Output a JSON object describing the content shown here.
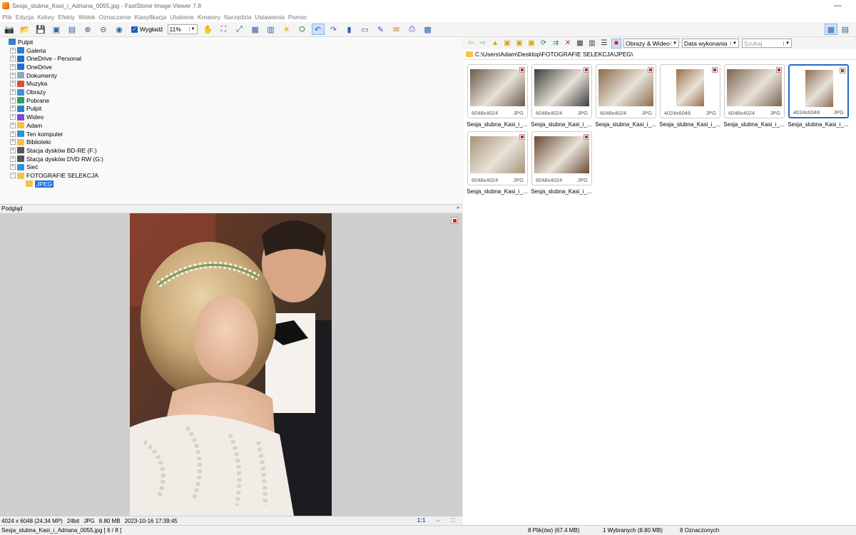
{
  "window": {
    "title": "Sesja_slubna_Kasi_i_Adriana_0055.jpg  -  FastStone Image Viewer 7.8",
    "minimize": "—"
  },
  "menu": [
    "Plik",
    "Edycja",
    "Kolory",
    "Efekty",
    "Widok",
    "Oznaczanie",
    "Klasyfikacja",
    "Ulubione",
    "Kreatory",
    "Narzędzia",
    "Ustawienia",
    "Pomoc"
  ],
  "toolbar": {
    "smooth_label": "Wygładź",
    "zoom_value": "11%",
    "icons": [
      "camera-icon",
      "open-folder-icon",
      "save-icon",
      "save-as-icon",
      "export-icon",
      "zoom-in-icon",
      "zoom-out-icon",
      "actual-size-icon"
    ],
    "icons2": [
      "hand-tool-icon",
      "crop-icon",
      "resize-icon",
      "color-icon",
      "compare-icon",
      "sun-icon",
      "stamp-icon",
      "rotate-icon",
      "rotate-right-icon",
      "histogram-icon",
      "slideshow-icon",
      "draw-icon",
      "email-icon",
      "print-icon",
      "scan-icon"
    ]
  },
  "tree": {
    "items": [
      {
        "label": "Pulpit",
        "color": "#3b82c4",
        "exp": "",
        "indent": 0
      },
      {
        "label": "Galeria",
        "color": "#2a7fd4",
        "exp": "+",
        "indent": 1
      },
      {
        "label": "OneDrive - Personal",
        "color": "#1e6fd0",
        "exp": "+",
        "indent": 1
      },
      {
        "label": "OneDrive",
        "color": "#1e6fd0",
        "exp": "+",
        "indent": 1
      },
      {
        "label": "Dokumenty",
        "color": "#8aa7c7",
        "exp": "+",
        "indent": 1
      },
      {
        "label": "Muzyka",
        "color": "#e04e3a",
        "exp": "+",
        "indent": 1
      },
      {
        "label": "Obrazy",
        "color": "#3f8fd6",
        "exp": "+",
        "indent": 1
      },
      {
        "label": "Pobrane",
        "color": "#26a65b",
        "exp": "+",
        "indent": 1
      },
      {
        "label": "Pulpit",
        "color": "#2d7fd0",
        "exp": "+",
        "indent": 1
      },
      {
        "label": "Wideo",
        "color": "#7b4bd6",
        "exp": "+",
        "indent": 1
      },
      {
        "label": "Adam",
        "color": "#f2c14e",
        "exp": "+",
        "indent": 1
      },
      {
        "label": "Ten komputer",
        "color": "#2f93d8",
        "exp": "+",
        "indent": 1
      },
      {
        "label": "Biblioteki",
        "color": "#f2c14e",
        "exp": "+",
        "indent": 1
      },
      {
        "label": "Stacja dysków BD-RE (F:)",
        "color": "#555555",
        "exp": "+",
        "indent": 1
      },
      {
        "label": "Stacja dysków DVD RW (G:)",
        "color": "#555555",
        "exp": "+",
        "indent": 1
      },
      {
        "label": "Sieć",
        "color": "#2f93d8",
        "exp": "+",
        "indent": 1
      },
      {
        "label": "FOTOGRAFIE SELEKCJA",
        "color": "#f2c14e",
        "exp": "−",
        "indent": 1
      },
      {
        "label": "JPEG",
        "color": "#f2c14e",
        "exp": "",
        "indent": 2,
        "selected": true
      }
    ]
  },
  "preview": {
    "header": "Podgląd",
    "collapse": "»",
    "status": [
      "4024 x 6048 (24.34 MP)",
      "24bit",
      "JPG",
      "8.80 MB",
      "2023-10-16 17:39:45"
    ],
    "ratio": "1:1"
  },
  "browser": {
    "filter": "Obrazy & Wideo",
    "sort": "Data wykonania",
    "search_placeholder": "Szukaj",
    "path": "C:\\Users\\Adam\\Desktop\\FOTOGRAFIE SELEKCJA\\JPEG\\",
    "thumbnails": [
      {
        "dims": "6048x4024",
        "type": "JPG",
        "name": "Sesja_slubna_Kasi_i_...",
        "orientation": "landscape",
        "tone": "#6b5a4a"
      },
      {
        "dims": "6048x4024",
        "type": "JPG",
        "name": "Sesja_slubna_Kasi_i_...",
        "orientation": "landscape",
        "tone": "#3d3d3d"
      },
      {
        "dims": "6048x4024",
        "type": "JPG",
        "name": "Sesja_slubna_Kasi_i_...",
        "orientation": "landscape",
        "tone": "#8a6a4a"
      },
      {
        "dims": "4024x6048",
        "type": "JPG",
        "name": "Sesja_slubna_Kasi_i_...",
        "orientation": "portrait",
        "tone": "#9a6d48"
      },
      {
        "dims": "6048x4024",
        "type": "JPG",
        "name": "Sesja_slubna_Kasi_i_...",
        "orientation": "landscape",
        "tone": "#7a6250"
      },
      {
        "dims": "4024x6048",
        "type": "JPG",
        "name": "Sesja_slubna_Kasi_i_...",
        "orientation": "portrait",
        "tone": "#8c6a52",
        "selected": true
      },
      {
        "dims": "6048x4024",
        "type": "JPG",
        "name": "Sesja_slubna_Kasi_i_...",
        "orientation": "landscape",
        "tone": "#a89278"
      },
      {
        "dims": "6048x4024",
        "type": "JPG",
        "name": "Sesja_slubna_Kasi_i_...",
        "orientation": "landscape",
        "tone": "#6a4a34"
      }
    ]
  },
  "statusbar": {
    "file": "Sesja_slubna_Kasi_i_Adriana_0055.jpg [ 6 / 8 ]",
    "files": "8 Plik(ów) (67.4 MB)",
    "selected": "1 Wybranych (8.80 MB)",
    "marked": "8 Oznaczonych"
  }
}
